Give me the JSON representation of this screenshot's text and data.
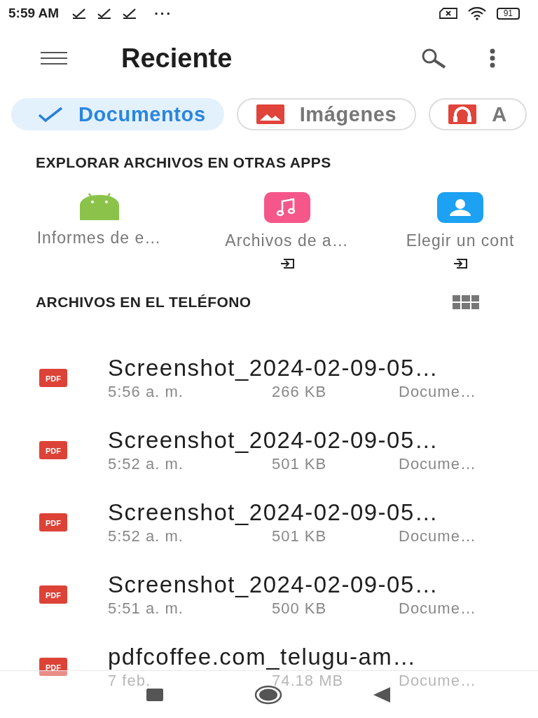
{
  "status_bar": {
    "time": "5:59 AM",
    "more": "···",
    "battery": "91"
  },
  "toolbar": {
    "title": "Reciente"
  },
  "chips": [
    {
      "label": "Documentos",
      "kind": "documents",
      "selected": true
    },
    {
      "label": "Imágenes",
      "kind": "images",
      "selected": false
    },
    {
      "label": "A",
      "kind": "audio",
      "selected": false
    }
  ],
  "apps_section": {
    "heading": "EXPLORAR ARCHIVOS EN OTRAS APPS",
    "apps": [
      {
        "label": "Informes de e…",
        "kind": "android",
        "external": false
      },
      {
        "label": "Archivos de a…",
        "kind": "music",
        "external": true
      },
      {
        "label": "Elegir un cont",
        "kind": "contact",
        "external": true
      }
    ]
  },
  "files_section": {
    "heading": "ARCHIVOS EN EL TELÉFONO",
    "files": [
      {
        "badge": "PDF",
        "name": "Screenshot_2024-02-09-05…",
        "time": "5:56 a. m.",
        "size": "266 KB",
        "type": "Docume…"
      },
      {
        "badge": "PDF",
        "name": "Screenshot_2024-02-09-05…",
        "time": "5:52 a. m.",
        "size": "501 KB",
        "type": "Docume…"
      },
      {
        "badge": "PDF",
        "name": "Screenshot_2024-02-09-05…",
        "time": "5:52 a. m.",
        "size": "501 KB",
        "type": "Docume…"
      },
      {
        "badge": "PDF",
        "name": "Screenshot_2024-02-09-05…",
        "time": "5:51 a. m.",
        "size": "500 KB",
        "type": "Docume…"
      },
      {
        "badge": "PDF",
        "name": "pdfcoffee.com_telugu-am…",
        "time": "7 feb.",
        "size": "74.18 MB",
        "type": "Docume…"
      }
    ]
  }
}
